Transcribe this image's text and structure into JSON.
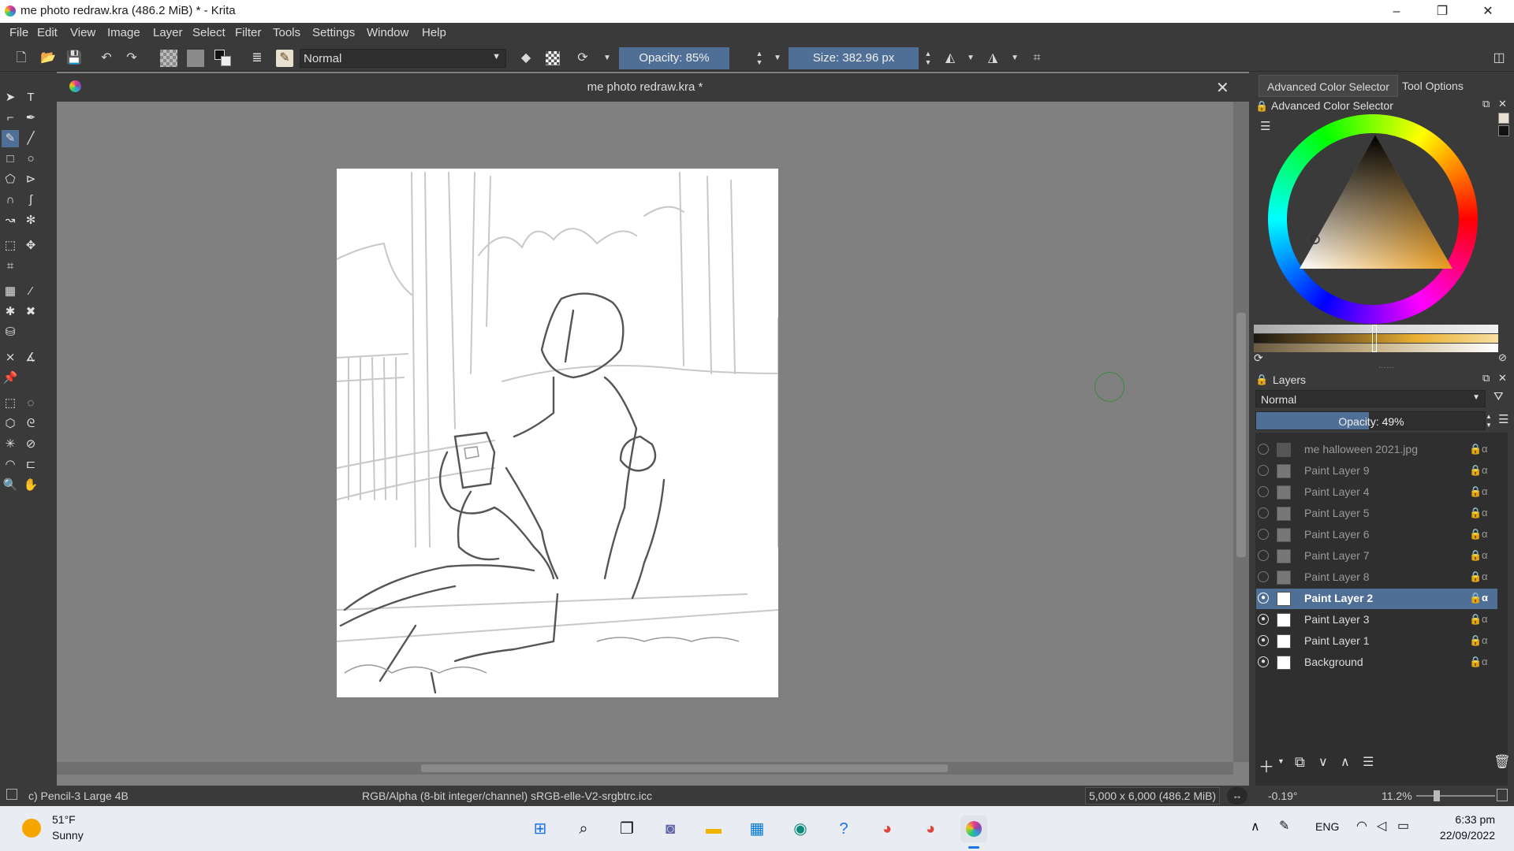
{
  "titlebar": {
    "title": "me photo redraw.kra (486.2 MiB)  * - Krita",
    "minimize": "–",
    "restore": "❐",
    "close": "✕"
  },
  "menu": [
    "File",
    "Edit",
    "View",
    "Image",
    "Layer",
    "Select",
    "Filter",
    "Tools",
    "Settings",
    "Window",
    "Help"
  ],
  "toolbar": {
    "blend_mode": "Normal",
    "opacity": "Opacity: 85%",
    "size": "Size: 382.96 px"
  },
  "document": {
    "tab_title": "me photo redraw.kra *"
  },
  "right_panel": {
    "tabs": [
      "Advanced Color Selector",
      "Tool Options"
    ],
    "color_selector_title": "Advanced Color Selector",
    "layers_title": "Layers",
    "layers_blend": "Normal",
    "layers_opacity": "Opacity:  49%",
    "layers": [
      {
        "name": "me halloween 2021.jpg",
        "visible": false,
        "active": false
      },
      {
        "name": "Paint Layer 9",
        "visible": false,
        "active": false
      },
      {
        "name": "Paint Layer 4",
        "visible": false,
        "active": false
      },
      {
        "name": "Paint Layer 5",
        "visible": false,
        "active": false
      },
      {
        "name": "Paint Layer 6",
        "visible": false,
        "active": false
      },
      {
        "name": "Paint Layer 7",
        "visible": false,
        "active": false
      },
      {
        "name": "Paint Layer 8",
        "visible": false,
        "active": false
      },
      {
        "name": "Paint Layer 2",
        "visible": true,
        "active": true
      },
      {
        "name": "Paint Layer 3",
        "visible": true,
        "active": false
      },
      {
        "name": "Paint Layer 1",
        "visible": true,
        "active": false
      },
      {
        "name": "Background",
        "visible": true,
        "active": false
      }
    ]
  },
  "statusbar": {
    "brush": "c) Pencil-3 Large 4B",
    "color_profile": "RGB/Alpha (8-bit integer/channel)  sRGB-elle-V2-srgbtrc.icc",
    "image_size": "5,000 x 6,000 (486.2 MiB)",
    "rotation": "-0.19°",
    "zoom": "11.2%"
  },
  "taskbar": {
    "weather_temp": "51°F",
    "weather_desc": "Sunny",
    "lang": "ENG",
    "time": "6:33 pm",
    "date": "22/09/2022"
  },
  "colors": {
    "accent": "#4f6f96",
    "canvas_bg": "#808080",
    "panel_bg": "#3a3a3a"
  }
}
